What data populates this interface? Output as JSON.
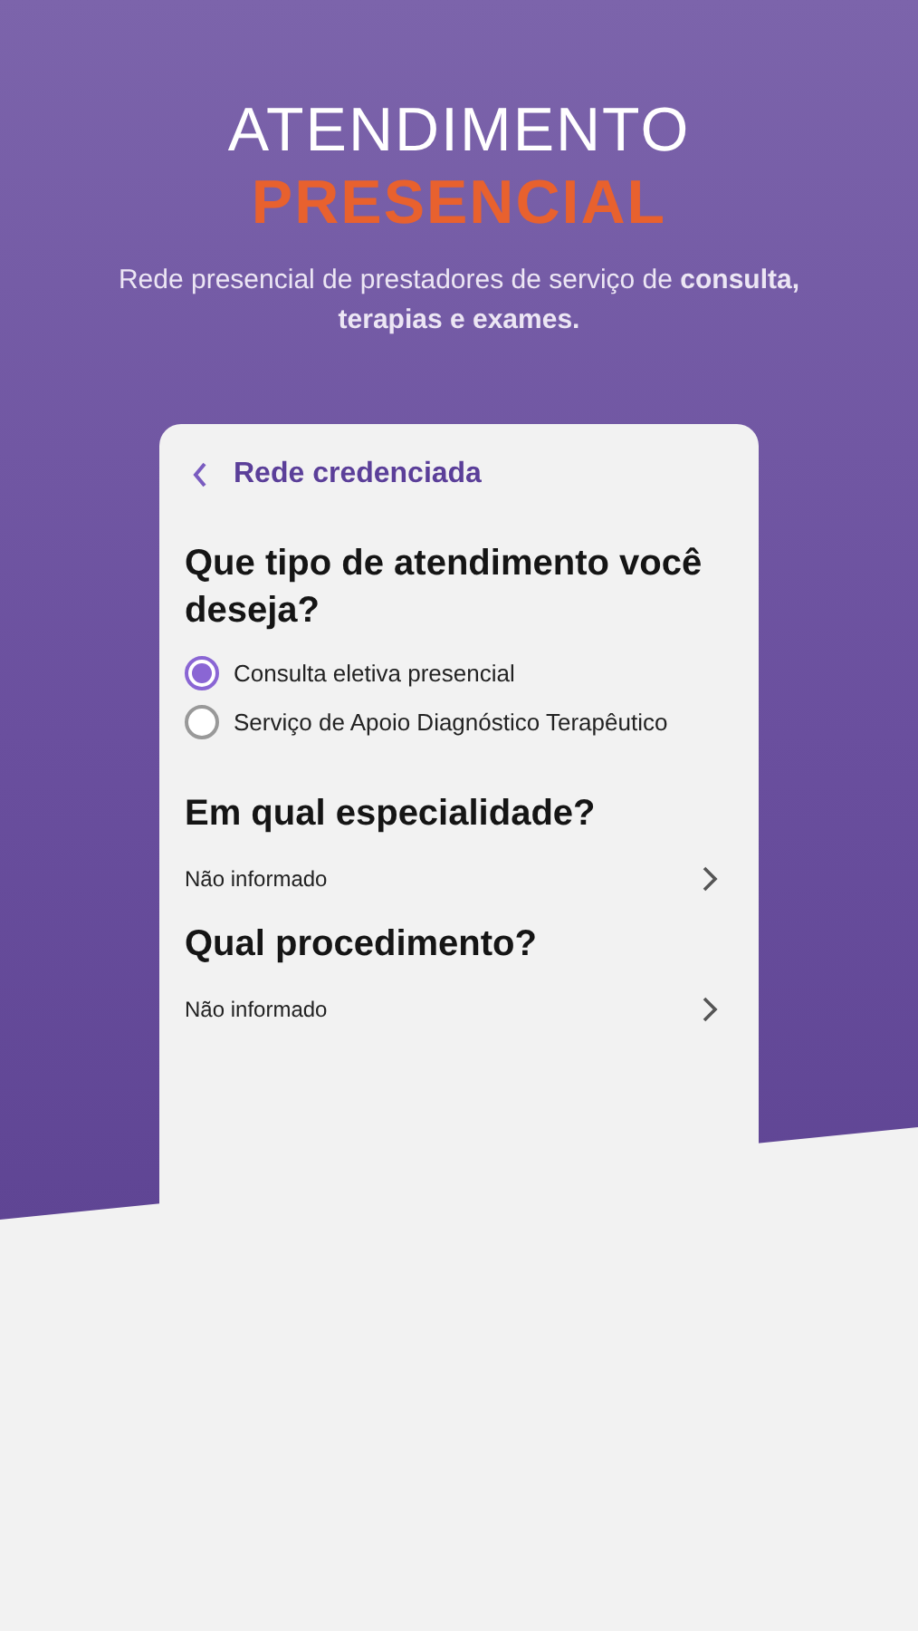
{
  "hero": {
    "title": "ATENDIMENTO",
    "highlight": "PRESENCIAL",
    "subtitle": "Rede presencial de prestadores de serviço de **consulta, terapias e exames.**"
  },
  "app": {
    "header": {
      "title": "Rede credenciada"
    },
    "question": "Que tipo de atendimento você deseja?",
    "options": [
      {
        "label": "Consulta eletiva presencial",
        "selected": true
      },
      {
        "label": "Serviço de Apoio Diagnóstico Terapêutico",
        "selected": false
      }
    ],
    "fields": [
      {
        "label": "Em qual especialidade?",
        "value": "Não informado"
      },
      {
        "label": "Qual procedimento?",
        "value": "Não informado"
      }
    ]
  }
}
